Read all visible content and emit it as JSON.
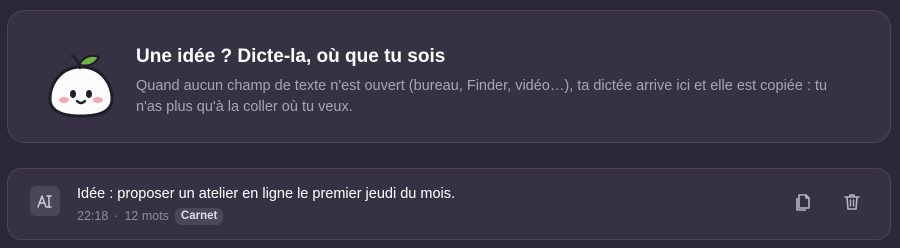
{
  "intro": {
    "title": "Une idée ? Dicte-la, où que tu sois",
    "description": "Quand aucun champ de texte n'est ouvert (bureau, Finder, vidéo…), ta dictée arrive ici et elle est copiée : tu n'as plus qu'à la coller où tu veux.",
    "mascot": "mascot-illustration"
  },
  "note": {
    "icon": "dictation-text-icon",
    "text": "Idée : proposer un atelier en ligne le premier jeudi du mois.",
    "time": "22:18",
    "separator": "·",
    "word_count": "12 mots",
    "tag": "Carnet",
    "actions": [
      {
        "icon": "copy-icon"
      },
      {
        "icon": "trash-icon"
      }
    ]
  },
  "colors": {
    "background": "#2b2839",
    "card": "#363244",
    "border": "#4a4558",
    "text": "#ffffff",
    "muted": "#a8a3b6",
    "leaf": "#6fb43f",
    "blush": "#f4a7b6"
  }
}
